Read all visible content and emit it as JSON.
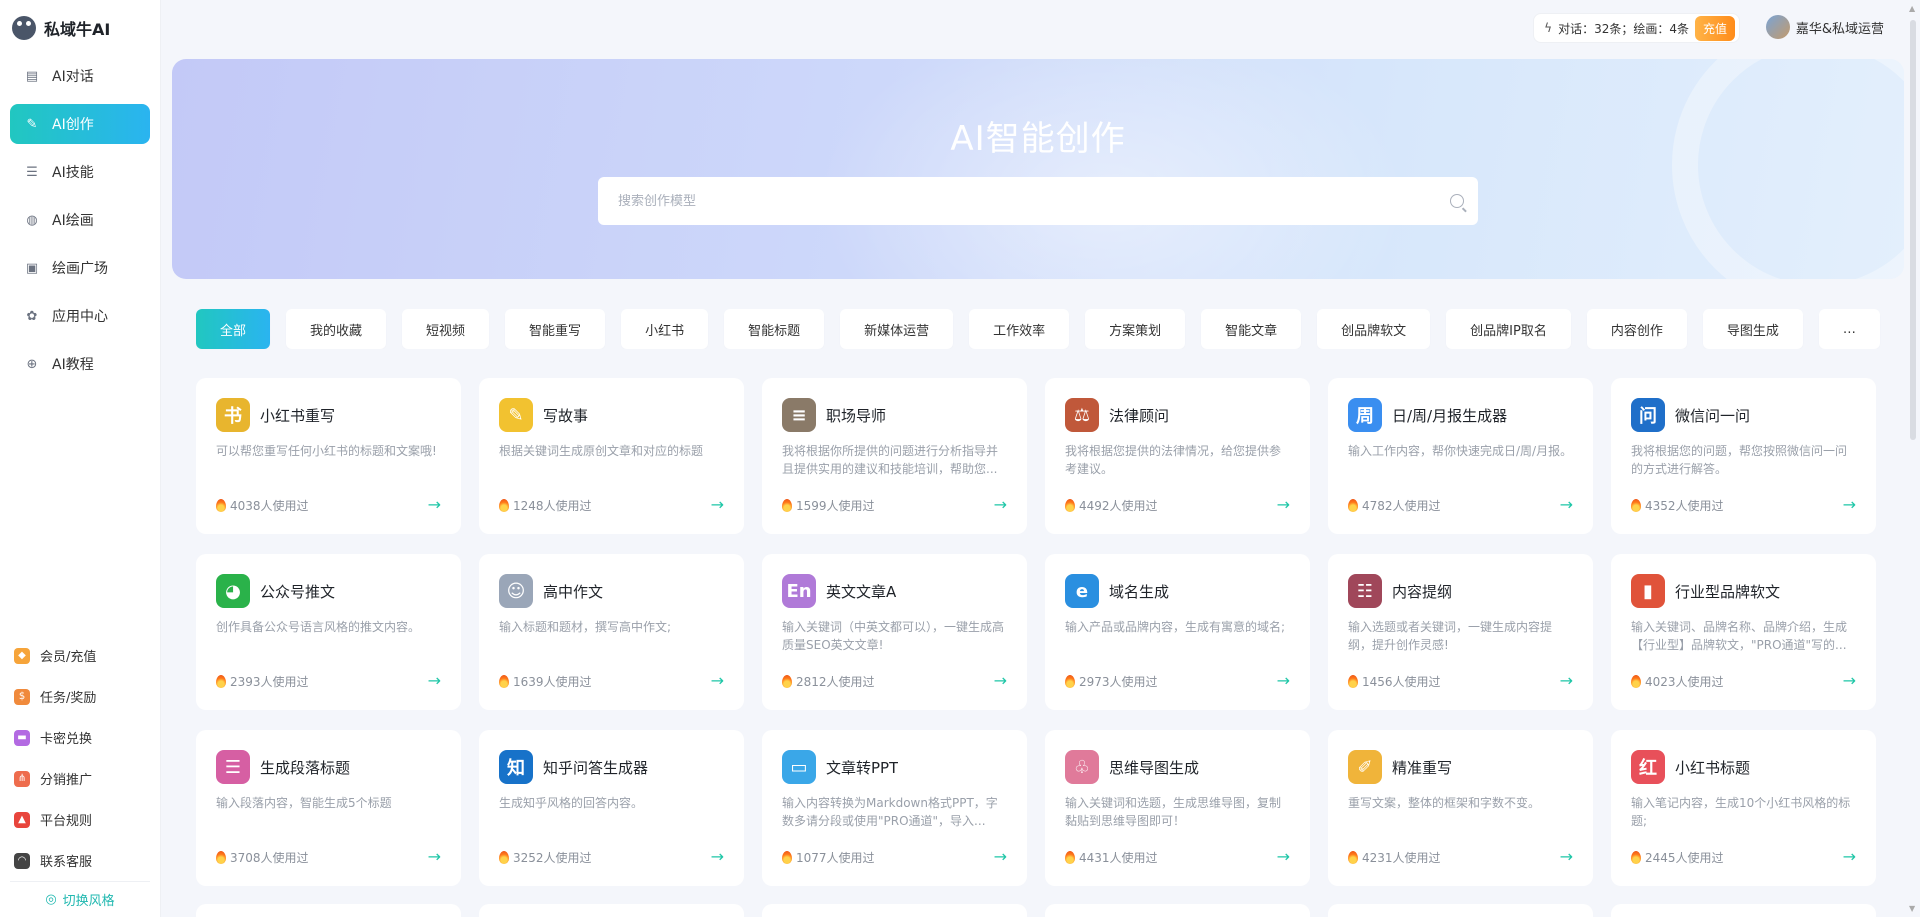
{
  "brand": {
    "name": "私域牛AI"
  },
  "sidebar": {
    "items": [
      {
        "label": "AI对话",
        "icon": "chat-icon",
        "glyph": "▤",
        "active": false
      },
      {
        "label": "AI创作",
        "icon": "pen-icon",
        "glyph": "✎",
        "active": true
      },
      {
        "label": "AI技能",
        "icon": "list-icon",
        "glyph": "☰",
        "active": false
      },
      {
        "label": "AI绘画",
        "icon": "palette-icon",
        "glyph": "◍",
        "active": false
      },
      {
        "label": "绘画广场",
        "icon": "image-icon",
        "glyph": "▣",
        "active": false
      },
      {
        "label": "应用中心",
        "icon": "apps-icon",
        "glyph": "✿",
        "active": false
      },
      {
        "label": "AI教程",
        "icon": "tutorial-icon",
        "glyph": "⊕",
        "active": false
      }
    ],
    "bottom_items": [
      {
        "label": "会员/充值",
        "icon": "vip-icon",
        "glyph": "◆",
        "color": "#f6a43a"
      },
      {
        "label": "任务/奖励",
        "icon": "reward-icon",
        "glyph": "$",
        "color": "#f08a3c"
      },
      {
        "label": "卡密兑换",
        "icon": "card-icon",
        "glyph": "▬",
        "color": "#b36ae2"
      },
      {
        "label": "分销推广",
        "icon": "share-icon",
        "glyph": "⋔",
        "color": "#ee6c4d"
      },
      {
        "label": "平台规则",
        "icon": "rules-icon",
        "glyph": "▲",
        "color": "#e8453c"
      },
      {
        "label": "联系客服",
        "icon": "headset-icon",
        "glyph": "◠",
        "color": "#444444"
      }
    ],
    "switch_style": "切换风格"
  },
  "topbar": {
    "quota_text": "对话：32条；绘画：4条",
    "recharge": "充值",
    "user_name": "嘉华&私域运营"
  },
  "banner": {
    "title": "AI智能创作",
    "search_placeholder": "搜索创作模型"
  },
  "tabs": [
    "全部",
    "我的收藏",
    "短视频",
    "智能重写",
    "小红书",
    "智能标题",
    "新媒体运营",
    "工作效率",
    "方案策划",
    "智能文章",
    "创品牌软文",
    "创品牌IP取名",
    "内容创作",
    "导图生成",
    "…"
  ],
  "active_tab": 0,
  "cards": [
    {
      "title": "小红书重写",
      "desc": "可以帮您重写任何小红书的标题和文案哦!",
      "usage": "4038人使用过",
      "icon": "book-icon",
      "glyph": "书",
      "color": "#e8b52e"
    },
    {
      "title": "写故事",
      "desc": "根据关键词生成原创文章和对应的标题",
      "usage": "1248人使用过",
      "icon": "notepad-icon",
      "glyph": "✎",
      "color": "#f2c230"
    },
    {
      "title": "职场导师",
      "desc": "我将根据你所提供的问题进行分析指导并且提供实用的建议和技能培训，帮助您...",
      "usage": "1599人使用过",
      "icon": "document-icon",
      "glyph": "≡",
      "color": "#8a7a68"
    },
    {
      "title": "法律顾问",
      "desc": "我将根据您提供的法律情况，给您提供参考建议。",
      "usage": "4492人使用过",
      "icon": "gavel-icon",
      "glyph": "⚖",
      "color": "#c0583a"
    },
    {
      "title": "日/周/月报生成器",
      "desc": "输入工作内容，帮你快速完成日/周/月报。",
      "usage": "4782人使用过",
      "icon": "calendar-icon",
      "glyph": "周",
      "color": "#3a8ef0"
    },
    {
      "title": "微信问一问",
      "desc": "我将根据您的问题，帮您按照微信问一问的方式进行解答。",
      "usage": "4352人使用过",
      "icon": "question-icon",
      "glyph": "问",
      "color": "#1f6fc9"
    },
    {
      "title": "公众号推文",
      "desc": "创作具备公众号语言风格的推文内容。",
      "usage": "2393人使用过",
      "icon": "wechat-icon",
      "glyph": "◕",
      "color": "#2ab24a"
    },
    {
      "title": "高中作文",
      "desc": "输入标题和题材，撰写高中作文;",
      "usage": "1639人使用过",
      "icon": "student-icon",
      "glyph": "☺",
      "color": "#9aa6b8"
    },
    {
      "title": "英文文章A",
      "desc": "输入关键词（中英文都可以），一键生成高质量SEO英文文章!",
      "usage": "2812人使用过",
      "icon": "english-icon",
      "glyph": "En",
      "color": "#b07ad8"
    },
    {
      "title": "域名生成",
      "desc": "输入产品或品牌内容，生成有寓意的域名;",
      "usage": "2973人使用过",
      "icon": "browser-icon",
      "glyph": "e",
      "color": "#2a8fe0"
    },
    {
      "title": "内容提纲",
      "desc": "输入选题或者关键词，一键生成内容提纲，提升创作灵感!",
      "usage": "1456人使用过",
      "icon": "outline-icon",
      "glyph": "☷",
      "color": "#a0475a"
    },
    {
      "title": "行业型品牌软文",
      "desc": "输入关键词、品牌名称、品牌介绍，生成【行业型】品牌软文，\"PRO通道\"写的...",
      "usage": "4023人使用过",
      "icon": "bar-chart-icon",
      "glyph": "▮",
      "color": "#e0533a"
    },
    {
      "title": "生成段落标题",
      "desc": "输入段落内容，智能生成5个标题",
      "usage": "3708人使用过",
      "icon": "paragraph-icon",
      "glyph": "☰",
      "color": "#d65fa3"
    },
    {
      "title": "知乎问答生成器",
      "desc": "生成知乎风格的回答内容。",
      "usage": "3252人使用过",
      "icon": "zhihu-icon",
      "glyph": "知",
      "color": "#1772c9"
    },
    {
      "title": "文章转PPT",
      "desc": "输入内容转换为Markdown格式PPT，字数多请分段或使用\"PRO通道\"，导入...",
      "usage": "1077人使用过",
      "icon": "ppt-icon",
      "glyph": "▭",
      "color": "#3aa7e8"
    },
    {
      "title": "思维导图生成",
      "desc": "输入关键词和选题，生成思维导图，复制黏贴到思维导图即可！",
      "usage": "4431人使用过",
      "icon": "mindmap-icon",
      "glyph": "♧",
      "color": "#e07a9a"
    },
    {
      "title": "精准重写",
      "desc": "重写文案，整体的框架和字数不变。",
      "usage": "4231人使用过",
      "icon": "edit-icon",
      "glyph": "✐",
      "color": "#f0b43a"
    },
    {
      "title": "小红书标题",
      "desc": "输入笔记内容，生成10个小红书风格的标题;",
      "usage": "2445人使用过",
      "icon": "redbook-icon",
      "glyph": "红",
      "color": "#e8505a"
    }
  ]
}
